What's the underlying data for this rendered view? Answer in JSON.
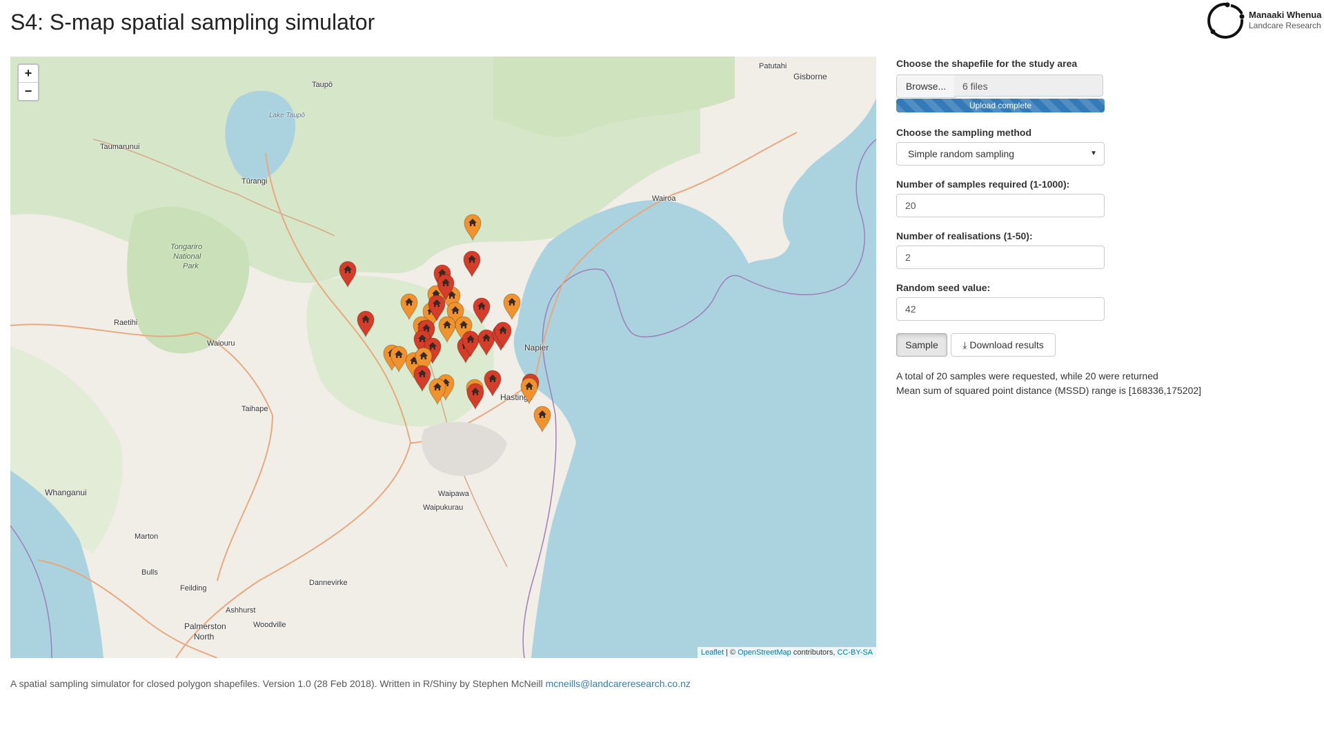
{
  "app": {
    "title": "S4: S-map spatial sampling simulator",
    "logo": {
      "line1": "Manaaki Whenua",
      "line2": "Landcare Research"
    }
  },
  "map": {
    "zoom_in": "+",
    "zoom_out": "−",
    "places": {
      "patutahi": "Patutahi",
      "gisborne": "Gisborne",
      "taupo": "Taupō",
      "lake_taupo": "Lake Taupō",
      "taumarunui": "Taumarunui",
      "turangi": "Tūrangi",
      "tongariro": "Tongariro",
      "national": "National",
      "park": "Park",
      "wairoa": "Wairoa",
      "raetihi": "Raetihi",
      "waiouru": "Waiouru",
      "napier": "Napier",
      "hastings": "Hastings",
      "taihape": "Taihape",
      "whanganui": "Whanganui",
      "waipawa": "Waipawa",
      "waipukurau": "Waipukurau",
      "marton": "Marton",
      "bulls": "Bulls",
      "dannevirke": "Dannevirke",
      "feilding": "Feilding",
      "ashhurst": "Ashhurst",
      "woodville": "Woodville",
      "palmerston": "Palmerston",
      "north": "North"
    },
    "attribution": {
      "leaflet": "Leaflet",
      "sep": " | © ",
      "osm": "OpenStreetMap",
      "contributors": " contributors, ",
      "license": "CC-BY-SA"
    },
    "marker_colors": {
      "realisation_1": "#d33d29",
      "realisation_2": "#f0932f"
    }
  },
  "controls": {
    "shapefile_label": "Choose the shapefile for the study area",
    "browse_label": "Browse...",
    "file_value": "6 files",
    "upload_status": "Upload complete",
    "upload_progress_pct": 100,
    "method_label": "Choose the sampling method",
    "method_value": "Simple random sampling",
    "samples_label": "Number of samples required (1-1000):",
    "samples_value": "20",
    "realisations_label": "Number of realisations (1-50):",
    "realisations_value": "2",
    "seed_label": "Random seed value:",
    "seed_value": "42",
    "sample_button": "Sample",
    "download_button": "Download results"
  },
  "results": {
    "line1": "A total of 20 samples were requested, while 20 were returned",
    "line2": "Mean sum of squared point distance (MSSD) range is [168336,175202]"
  },
  "footer": {
    "text": "A spatial sampling simulator for closed polygon shapefiles. Version 1.0 (28 Feb 2018). Written in R/Shiny by Stephen McNeill ",
    "email": "mcneills@landcareresearch.co.nz"
  }
}
